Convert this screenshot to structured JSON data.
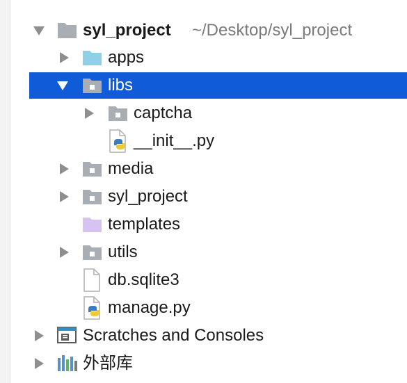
{
  "project_tree": {
    "root": {
      "name": "syl_project",
      "path": "~/Desktop/syl_project",
      "icon": "folder-icon",
      "expanded": true
    },
    "items": [
      {
        "label": "apps",
        "icon": "package-folder-icon",
        "expandable": true,
        "expanded": false
      },
      {
        "label": "libs",
        "icon": "python-package-icon",
        "expandable": true,
        "expanded": true,
        "selected": true
      },
      {
        "label": "captcha",
        "icon": "python-package-icon",
        "expandable": true,
        "expanded": false
      },
      {
        "label": "__init__.py",
        "icon": "python-file-icon",
        "expandable": false
      },
      {
        "label": "media",
        "icon": "python-package-icon",
        "expandable": true,
        "expanded": false
      },
      {
        "label": "syl_project",
        "icon": "python-package-icon",
        "expandable": true,
        "expanded": false
      },
      {
        "label": "templates",
        "icon": "templates-folder-icon",
        "expandable": false
      },
      {
        "label": "utils",
        "icon": "python-package-icon",
        "expandable": true,
        "expanded": false
      },
      {
        "label": "db.sqlite3",
        "icon": "file-icon",
        "expandable": false
      },
      {
        "label": "manage.py",
        "icon": "python-file-icon",
        "expandable": false
      }
    ],
    "scratches": {
      "label": "Scratches and Consoles",
      "icon": "scratches-icon",
      "expandable": true
    },
    "external_libraries": {
      "label": "外部库",
      "icon": "libraries-icon",
      "expandable": true
    }
  },
  "colors": {
    "selection": "#0f5bd8",
    "arrow": "#8f8f8f",
    "folder_gray": "#a9aeb4",
    "folder_cyan": "#8fd0e8",
    "folder_purple": "#d6c3f2",
    "python_blue": "#3d7bbf",
    "python_yellow": "#f0c93b"
  }
}
